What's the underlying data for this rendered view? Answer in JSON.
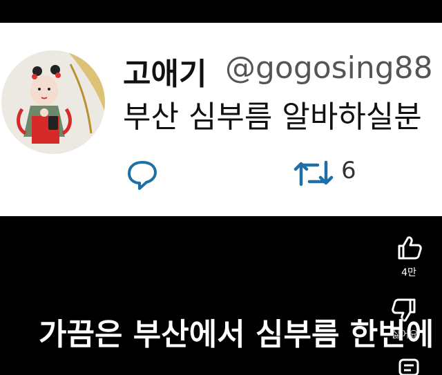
{
  "tweet": {
    "user_name": "고애기",
    "handle": "@gogosing88",
    "text": "부산 심부름 알바하실분",
    "retweet_count": "6"
  },
  "side_actions": {
    "like_count": "4만",
    "dislike_label": "싫어요"
  },
  "caption": "가끔은 부산에서 심부름 한번에",
  "colors": {
    "background": "#000000",
    "card": "#ffffff",
    "icon_blue": "#1d6fa5"
  },
  "icons": [
    "reply-icon",
    "retweet-icon",
    "thumbs-up-icon",
    "thumbs-down-icon",
    "comments-icon"
  ]
}
